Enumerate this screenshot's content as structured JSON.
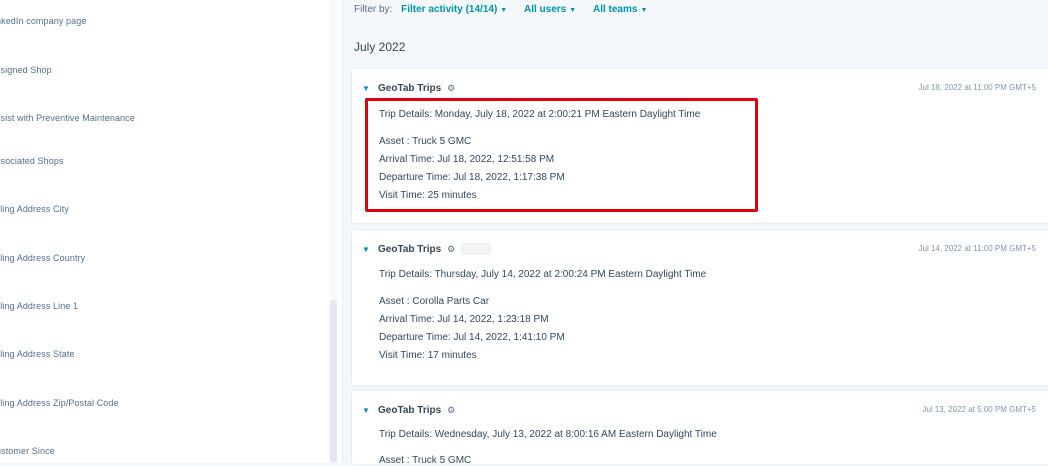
{
  "sidebar": {
    "items": [
      "nkedIn company page",
      "ssigned Shop",
      "ssist with Preventive Maintenance",
      "ssociated Shops",
      "illing Address City",
      "illing Address Country",
      "illing Address Line 1",
      "illing Address State",
      "illing Address Zip/Postal Code",
      "ustomer Since"
    ]
  },
  "filter": {
    "label": "Filter by:",
    "activity": "Filter activity (14/14)",
    "users": "All users",
    "teams": "All teams"
  },
  "month": "July 2022",
  "cards": [
    {
      "title": "GeoTab Trips",
      "date": "Jul 18, 2022 at 11:00 PM GMT+5",
      "details": "Trip Details: Monday, July 18, 2022 at 2:00:21 PM Eastern Daylight Time",
      "asset": "Asset : Truck 5 GMC",
      "arrival": "Arrival Time: Jul 18, 2022, 12:51:58 PM",
      "departure": "Departure Time: Jul 18, 2022, 1:17:38 PM",
      "visit": "Visit Time: 25 minutes"
    },
    {
      "title": "GeoTab Trips",
      "date": "Jul 14, 2022 at 11:00 PM GMT+5",
      "details": "Trip Details: Thursday, July 14, 2022 at 2:00:24 PM Eastern Daylight Time",
      "asset": "Asset : Corolla Parts Car",
      "arrival": "Arrival Time: Jul 14, 2022, 1:23:18 PM",
      "departure": "Departure Time: Jul 14, 2022, 1:41:10 PM",
      "visit": "Visit Time: 17 minutes"
    },
    {
      "title": "GeoTab Trips",
      "date": "Jul 13, 2022 at 5:00 PM GMT+5",
      "details": "Trip Details: Wednesday, July 13, 2022 at 8:00:16 AM Eastern Daylight Time",
      "asset": "Asset : Truck 5 GMC"
    }
  ],
  "icons": {
    "chevron": "chevron-down-icon",
    "gear": "gear-icon",
    "caret": "caret-down-icon"
  },
  "colors": {
    "accent": "#0091ae",
    "highlight": "#e0000a",
    "text": "#33475b"
  }
}
